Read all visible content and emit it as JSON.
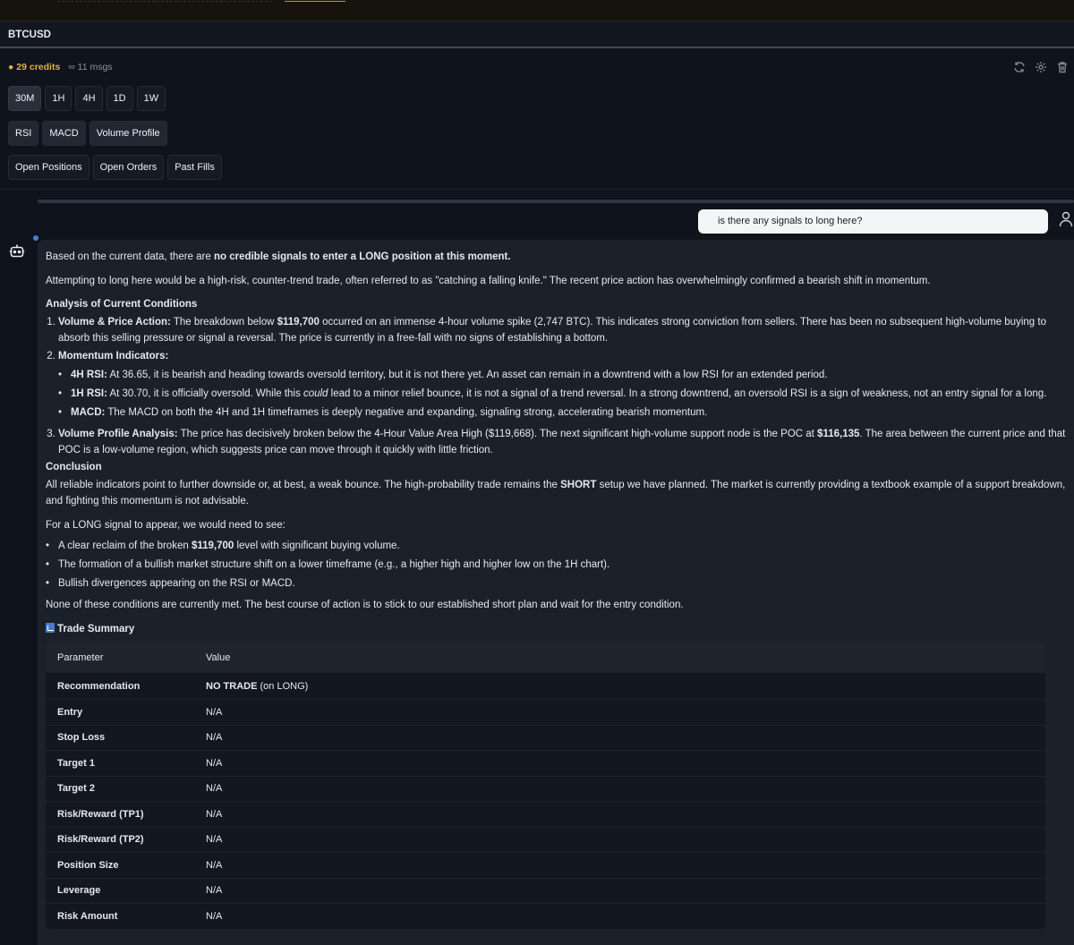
{
  "header": {
    "symbol": "BTCUSD"
  },
  "status": {
    "credits": "29 credits",
    "msgs": "11 msgs"
  },
  "timeframes": [
    "30M",
    "1H",
    "4H",
    "1D",
    "1W"
  ],
  "indicators": [
    "RSI",
    "MACD",
    "Volume Profile"
  ],
  "orders": [
    "Open Positions",
    "Open Orders",
    "Past Fills"
  ],
  "user_message": "is there any signals to long here?",
  "response": {
    "p1_a": "Based on the current data, there are ",
    "p1_b": "no credible signals to enter a LONG position at this moment.",
    "p2": "Attempting to long here would be a high-risk, counter-trend trade, often referred to as \"catching a falling knife.\" The recent price action has overwhelmingly confirmed a bearish shift in momentum.",
    "h_analysis": "Analysis of Current Conditions",
    "li1_label": "Volume & Price Action:",
    "li1_a": " The breakdown below ",
    "li1_price": "$119,700",
    "li1_b": " occurred on an immense 4-hour volume spike (2,747 BTC). This indicates strong conviction from sellers. There has been no subsequent high-volume buying to absorb this selling pressure or signal a reversal. The price is currently in a free-fall with no signs of establishing a bottom.",
    "li2_label": "Momentum Indicators:",
    "m1_label": "4H RSI:",
    "m1_text": " At 36.65, it is bearish and heading towards oversold territory, but it is not there yet. An asset can remain in a downtrend with a low RSI for an extended period.",
    "m2_label": "1H RSI:",
    "m2_a": " At 30.70, it is officially oversold. While this ",
    "m2_i": "could",
    "m2_b": " lead to a minor relief bounce, it is not a signal of a trend reversal. In a strong downtrend, an oversold RSI is a sign of weakness, not an entry signal for a long.",
    "m3_label": "MACD:",
    "m3_text": " The MACD on both the 4H and 1H timeframes is deeply negative and expanding, signaling strong, accelerating bearish momentum.",
    "li3_label": "Volume Profile Analysis:",
    "li3_a": " The price has decisively broken below the 4-Hour Value Area High ($119,668). The next significant high-volume support node is the POC at ",
    "li3_price": "$116,135",
    "li3_b": ". The area between the current price and that POC is a low-volume region, which suggests price can move through it quickly with little friction.",
    "h_conclusion": "Conclusion",
    "c1_a": "All reliable indicators point to further downside or, at best, a weak bounce. The high-probability trade remains the ",
    "c1_b": "SHORT",
    "c1_c": " setup we have planned. The market is currently providing a textbook example of a support breakdown, and fighting this momentum is not advisable.",
    "c2": "For a LONG signal to appear, we would need to see:",
    "n1_a": "A clear reclaim of the broken ",
    "n1_b": "$119,700",
    "n1_c": " level with significant buying volume.",
    "n2": "The formation of a bullish market structure shift on a lower timeframe (e.g., a higher high and higher low on the 1H chart).",
    "n3": "Bullish divergences appearing on the RSI or MACD.",
    "c3": "None of these conditions are currently met. The best course of action is to stick to our established short plan and wait for the entry condition.",
    "summary_title": "Trade Summary"
  },
  "table": {
    "head": [
      "Parameter",
      "Value"
    ],
    "rows": [
      [
        "Recommendation",
        "NO TRADE",
        " (on LONG)"
      ],
      [
        "Entry",
        "N/A"
      ],
      [
        "Stop Loss",
        "N/A"
      ],
      [
        "Target 1",
        "N/A"
      ],
      [
        "Target 2",
        "N/A"
      ],
      [
        "Risk/Reward (TP1)",
        "N/A"
      ],
      [
        "Risk/Reward (TP2)",
        "N/A"
      ],
      [
        "Position Size",
        "N/A"
      ],
      [
        "Leverage",
        "N/A"
      ],
      [
        "Risk Amount",
        "N/A"
      ]
    ]
  }
}
